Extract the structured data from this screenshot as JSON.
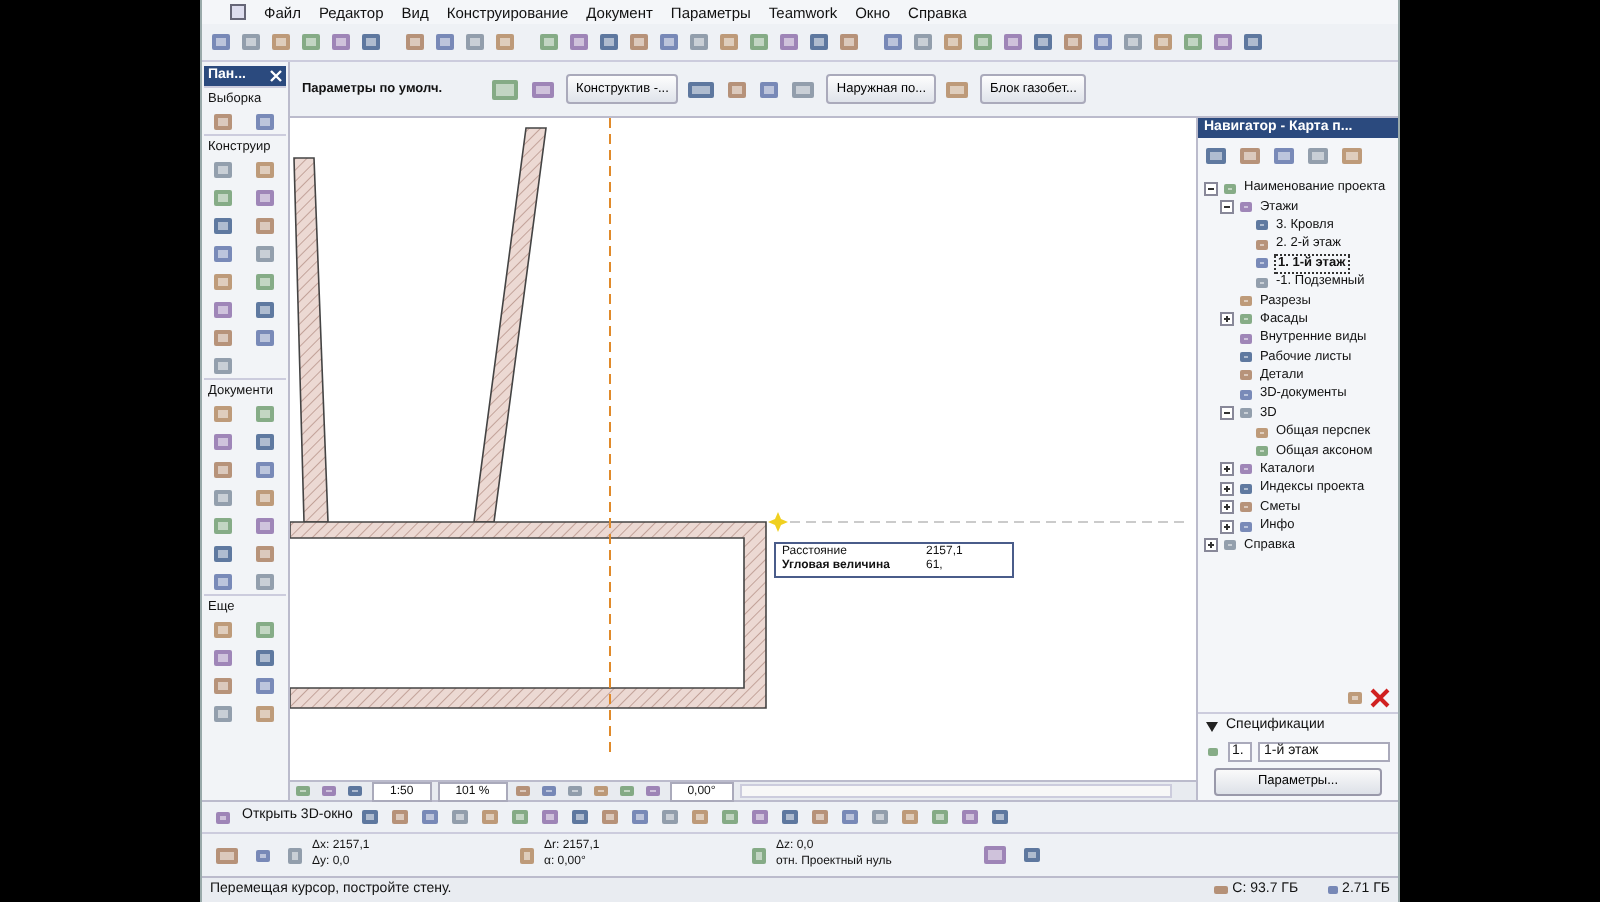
{
  "menu": [
    "Файл",
    "Редактор",
    "Вид",
    "Конструирование",
    "Документ",
    "Параметры",
    "Teamwork",
    "Окно",
    "Справка"
  ],
  "info_box": {
    "defaults_label": "Параметры по умолч.",
    "fields": [
      "Конструктив -...",
      "Наружная по...",
      "Блок газобет..."
    ]
  },
  "toolbox": {
    "title": "Пан...",
    "sections": [
      "Выборка",
      "Конструир",
      "Документи",
      "Еще"
    ]
  },
  "canvas": {
    "tracker": [
      {
        "label": "Расстояние",
        "value": "2157,1"
      },
      {
        "label": "Угловая величина",
        "value": "61,"
      }
    ],
    "scale": "1:50",
    "zoom": "101 %",
    "angle": "0,00°"
  },
  "navigator": {
    "title": "Навигатор - Карта п...",
    "tree": [
      {
        "label": "Наименование проекта",
        "expanded": true,
        "selected": false,
        "children": [
          {
            "label": "Этажи",
            "expanded": true,
            "selected": false,
            "children": [
              {
                "label": "3. Кровля",
                "selected": false
              },
              {
                "label": "2. 2-й этаж",
                "selected": false
              },
              {
                "label": "1. 1-й этаж",
                "selected": true
              },
              {
                "label": "-1. Подземный",
                "selected": false
              }
            ]
          },
          {
            "label": "Разрезы",
            "selected": false
          },
          {
            "label": "Фасады",
            "expanded": false,
            "selected": false
          },
          {
            "label": "Внутренние виды",
            "selected": false
          },
          {
            "label": "Рабочие листы",
            "selected": false
          },
          {
            "label": "Детали",
            "selected": false
          },
          {
            "label": "3D-документы",
            "selected": false
          },
          {
            "label": "3D",
            "expanded": true,
            "selected": false,
            "children": [
              {
                "label": "Общая перспек",
                "selected": false
              },
              {
                "label": "Общая аксоном",
                "selected": false
              }
            ]
          },
          {
            "label": "Каталоги",
            "expanded": false,
            "selected": false
          },
          {
            "label": "Индексы проекта",
            "expanded": false,
            "selected": false
          },
          {
            "label": "Сметы",
            "expanded": false,
            "selected": false
          },
          {
            "label": "Инфо",
            "expanded": false,
            "selected": false
          }
        ]
      },
      {
        "label": "Справка",
        "expanded": false,
        "selected": false
      }
    ],
    "specs": {
      "label": "Спецификации",
      "number": "1.",
      "name": "1-й этаж",
      "button": "Параметры..."
    }
  },
  "bottom_toolbar": {
    "open_3d": "Открыть 3D-окно"
  },
  "coordinates": [
    {
      "lines": [
        "Δx: 2157,1",
        "Δy: 0,0"
      ]
    },
    {
      "lines": [
        "Δr: 2157,1",
        "α: 0,00°"
      ]
    },
    {
      "lines": [
        "Δz: 0,0",
        "отн. Проектный нуль"
      ]
    }
  ],
  "status_bar": {
    "message": "Перемещая курсор, постройте стену.",
    "disk": "C: 93.7 ГБ",
    "memory": "2.71 ГБ"
  }
}
